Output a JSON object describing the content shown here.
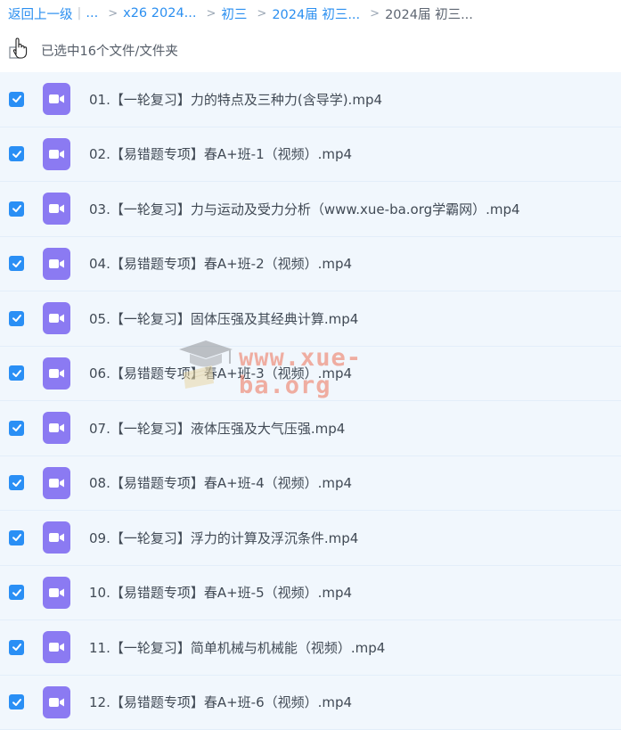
{
  "breadcrumb": {
    "back": "返回上一级",
    "sep": "|",
    "ellipsis": "...",
    "items": [
      "x26 2024...",
      "初三",
      "2024届 初三..."
    ],
    "current": "2024届 初三..."
  },
  "selection": {
    "text": "已选中16个文件/文件夹"
  },
  "files": [
    "01.【一轮复习】力的特点及三种力(含导学).mp4",
    "02.【易错题专项】春A+班-1（视频）.mp4",
    "03.【一轮复习】力与运动及受力分析（www.xue-ba.org学霸网）.mp4",
    "04.【易错题专项】春A+班-2（视频）.mp4",
    "05.【一轮复习】固体压强及其经典计算.mp4",
    "06.【易错题专项】春A+班-3（视频）.mp4",
    "07.【一轮复习】液体压强及大气压强.mp4",
    "08.【易错题专项】春A+班-4（视频）.mp4",
    "09.【一轮复习】浮力的计算及浮沉条件.mp4",
    "10.【易错题专项】春A+班-5（视频）.mp4",
    "11.【一轮复习】简单机械与机械能（视频）.mp4",
    "12.【易错题专项】春A+班-6（视频）.mp4"
  ],
  "watermark": {
    "text": "www.xue-ba.org"
  },
  "colors": {
    "accent": "#2a8ff5",
    "row_bg": "#f1f7fd",
    "video_icon": "#8b7af2"
  }
}
